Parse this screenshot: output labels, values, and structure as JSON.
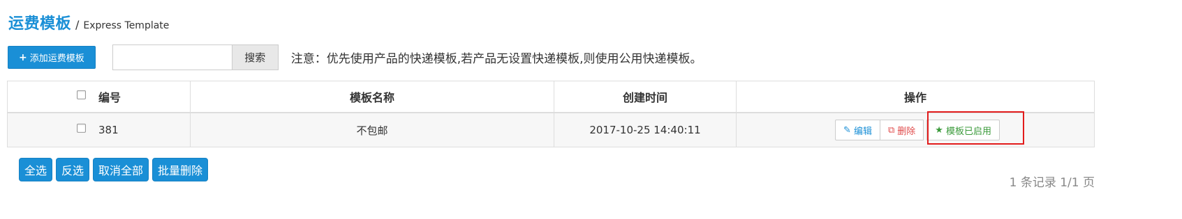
{
  "header": {
    "title": "运费模板",
    "separator": "/",
    "subtitle": "Express Template"
  },
  "toolbar": {
    "add_icon": "+",
    "add_label": "添加运费模板",
    "search_value": "",
    "search_placeholder": "",
    "search_button": "搜索",
    "notice": "注意：优先使用产品的快递模板,若产品无设置快递模板,则使用公用快递模板。"
  },
  "table": {
    "columns": [
      "编号",
      "模板名称",
      "创建时间",
      "操作"
    ],
    "rows": [
      {
        "id": "381",
        "name": "不包邮",
        "created": "2017-10-25 14:40:11",
        "actions": {
          "edit": "编辑",
          "delete": "删除",
          "enabled": "模板已启用"
        }
      }
    ]
  },
  "bulk_actions": {
    "select_all": "全选",
    "invert": "反选",
    "cancel_all": "取消全部",
    "batch_delete": "批量删除"
  },
  "pagination": {
    "summary": "1 条记录 1/1 页"
  },
  "icons": {
    "edit": "edit-icon",
    "delete": "delete-icon",
    "enabled": "star-icon"
  },
  "colors": {
    "accent": "#1a8fd6",
    "danger": "#e04b4b",
    "success": "#3a9a3a",
    "highlight": "#e21c1c"
  }
}
